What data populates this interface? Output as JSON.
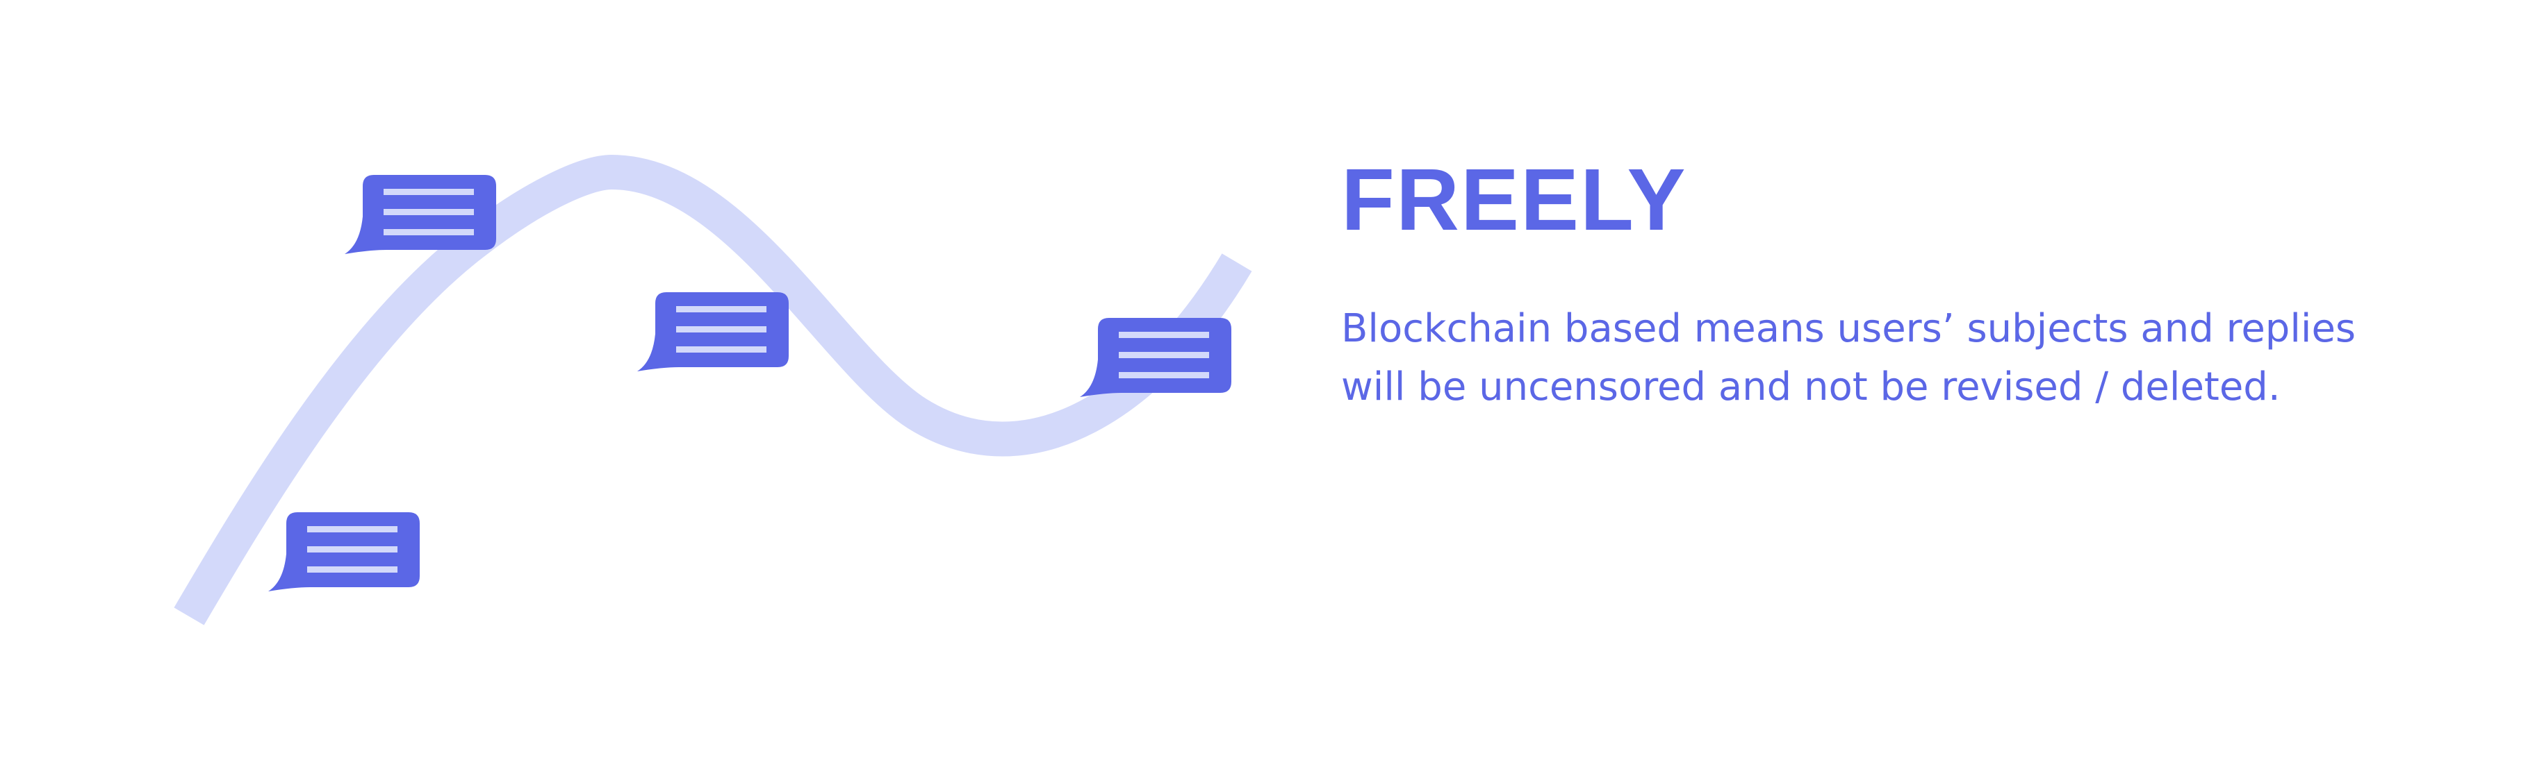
{
  "feature": {
    "title": "FREELY",
    "description_lines": [
      "Blockchain based means users’ subjects and replies",
      "will be uncensored and not be revised / deleted."
    ]
  },
  "colors": {
    "accent": "#5b67e6",
    "wave": "#d3d9fa",
    "bubble_lines": "#d3d9fa",
    "background": "#ffffff"
  },
  "icons": [
    "wave-line",
    "message-bubble-icon"
  ]
}
